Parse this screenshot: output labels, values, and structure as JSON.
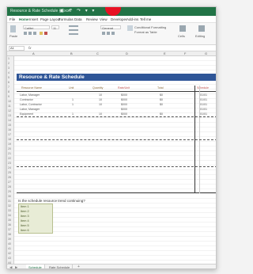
{
  "window": {
    "title": "Resource & Rate Schedule - Excel",
    "quick_access": "▣ ↶ ↷ ▾ ▾",
    "accent": "#217346",
    "record_color": "#e81123"
  },
  "menu": {
    "items": [
      "File",
      "Home",
      "Insert",
      "Page Layout",
      "Formulas",
      "Data",
      "Review",
      "View",
      "Developer",
      "Add-ins",
      "Tell me"
    ],
    "active_index": 1
  },
  "ribbon": {
    "clipboard_label": "Paste",
    "font_name": "Calibri",
    "font_size": "11",
    "number_format": "General",
    "conditional_label": "Conditional Formatting",
    "styles_label": "Format as Table",
    "cells_label": "Cells",
    "editing_label": "Editing"
  },
  "formula_bar": {
    "name_box": "A1",
    "fx": "fx"
  },
  "columns": [
    "A",
    "B",
    "C",
    "D",
    "E",
    "F",
    "G"
  ],
  "rows": [
    "1",
    "2",
    "3",
    "4",
    "5",
    "6",
    "7",
    "8",
    "9",
    "10",
    "11",
    "12",
    "13",
    "14",
    "15",
    "16",
    "17",
    "18",
    "19",
    "20",
    "21",
    "22",
    "23",
    "24",
    "25",
    "26",
    "27",
    "28",
    "29",
    "30",
    "31",
    "32",
    "33",
    "34",
    "35",
    "36",
    "37",
    "38",
    "39",
    "40",
    "41",
    "42",
    "43",
    "44"
  ],
  "sheet": {
    "banner_title": "Resource & Rate Schedule",
    "banner_color": "#2e5597",
    "headers": [
      "Resource Name",
      "Unit",
      "Quantity",
      "Rate/Unit",
      "Total",
      "Schedule"
    ],
    "table_rows": [
      [
        "Labor, Manager",
        "",
        "10",
        "$000",
        "$0",
        "01/01"
      ],
      [
        "Contractor",
        "1",
        "10",
        "$000",
        "$0",
        "01/01"
      ],
      [
        "Labor, Contractor",
        "1",
        "10",
        "$000",
        "$0",
        "01/01"
      ],
      [
        "Labor, Manager",
        "",
        "",
        "$000",
        "",
        "01/01"
      ],
      [
        "Equipment",
        "1",
        "10",
        "$000",
        "$0",
        "01/01"
      ]
    ],
    "question": "Is the schedule resource trend continuing?",
    "list_items": [
      "Item 1",
      "Item 2",
      "Item 3",
      "Item 4",
      "Item 5",
      "Item 6"
    ]
  },
  "tabs": {
    "items": [
      "Schedule",
      "Rate Schedule"
    ],
    "active_index": 0,
    "add": "+"
  }
}
